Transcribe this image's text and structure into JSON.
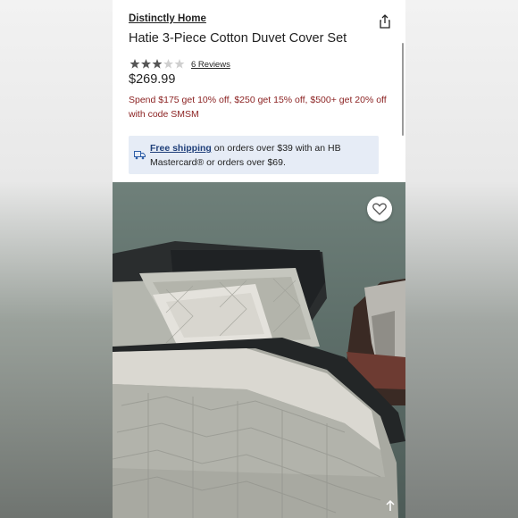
{
  "product": {
    "brand": "Distinctly Home",
    "title": "Hatie 3-Piece Cotton Duvet Cover Set",
    "rating": 3,
    "rating_max": 5,
    "reviews_label": "6 Reviews",
    "price": "$269.99",
    "promo": "Spend $175 get 10% off, $250 get 15% off, $500+ get 20% off with code SMSM"
  },
  "shipping": {
    "link_label": "Free shipping",
    "text": " on orders over $39 with an HB Mastercard® or orders over $69."
  },
  "icons": {
    "share": "share-icon",
    "truck": "truck-icon",
    "heart": "heart-icon",
    "scroll_top": "arrow-up-icon"
  },
  "colors": {
    "promo_text": "#8a1f1f",
    "shipping_banner": "#e6ecf6",
    "star_filled": "#555555",
    "star_empty": "#cfcfcf"
  }
}
